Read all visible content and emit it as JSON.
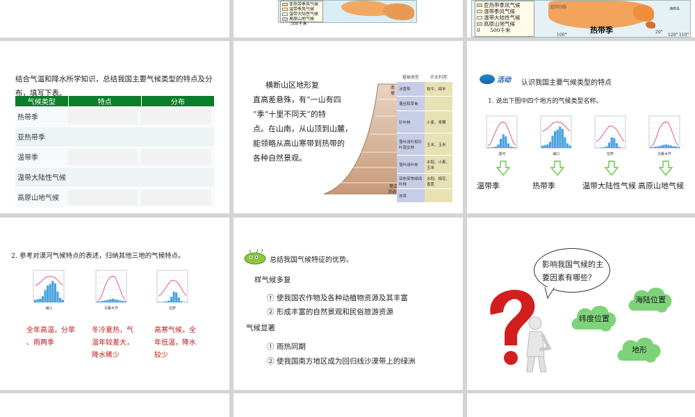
{
  "top_slides": {
    "mid_legend": [
      "亚热带季风气候",
      "温带季风气候",
      "温带大陆性气候",
      "高原山地气候"
    ],
    "mid_scale": "500千米",
    "right_legend": [
      "亚热带季风气候",
      "温带季风气候",
      "温带大陆性气候",
      "高原山地气候"
    ],
    "right_scale_0": "0",
    "right_scale": "500千米",
    "right_lat_label": "北回归线",
    "right_lon1": "100°",
    "right_lon2": "120°",
    "right_lon3": "110°",
    "right_lat2": "20°",
    "right_bottom_label": "热带季",
    "right_island": "海南岛"
  },
  "slide_table": {
    "intro": "结合气温和降水所学知识，总结我国主要气候类型的特点及分布，填写下表。",
    "headers": [
      "气候类型",
      "特点",
      "分布"
    ],
    "rows": [
      "热带季",
      "亚热带季",
      "温带季",
      "温带大陆性气候",
      "高原山地气候"
    ]
  },
  "slide_hengduan": {
    "line1": "横断山区地形复",
    "line2": "直高差悬殊，有“一山有四",
    "line3": "”季“十里不同天”的特",
    "line4": "点。在山南，从山顶到山麓，",
    "line5": "能领略从高山寒带到热带的",
    "line6": "各种自然景观。",
    "col_head_1": "植被类型",
    "col_head_2": "农业利用",
    "top_label": "南",
    "top_label_2": "坡",
    "bottom_label": "怒江",
    "bottom_label_2": "河谷",
    "veg_rows": [
      {
        "veg": "冰雪带",
        "agri": "牧牛、绵羊"
      },
      {
        "veg": "灌丛和草甸",
        "agri": ""
      },
      {
        "veg": "针叶林",
        "agri": "小麦、青稞"
      },
      {
        "veg": "落叶阔叶和针叶混交林",
        "agri": "玉米、玉米"
      },
      {
        "veg": "落叶阔叶林",
        "agri": "水稻、小麦、玉米"
      },
      {
        "veg": "亚热带常绿阔叶林",
        "agri": "水稻、棉花、香蕉"
      },
      {
        "veg": "热带",
        "agri": ""
      }
    ]
  },
  "slide_activity": {
    "logo": "活动",
    "title": "认识我国主要气候类型的特点",
    "question": "1. 说出下图中四个地方的气候类型名称。",
    "charts": [
      "漠河",
      "海口",
      "拉萨",
      "乌鲁木齐"
    ],
    "labels": [
      "温带季",
      "热带季",
      "温带大陆性气候",
      "高原山地气候"
    ]
  },
  "slide_features": {
    "title": "2. 参考对漠河气候特点的表述，归纳其他三地的气候特点。",
    "charts": [
      "海口",
      "乌鲁木齐",
      "拉萨"
    ],
    "desc1": [
      "全年高温，分旱",
      "、雨两季"
    ],
    "desc2": [
      "冬冷夏热，气",
      "温年较差大，",
      "降水稀少"
    ],
    "desc3": [
      "高寒气候，全",
      "年低温，降水",
      "较少"
    ]
  },
  "slide_advantages": {
    "title": "总结我国气候特征的优势。",
    "h1": "样气候多复",
    "item1": "① 使我国农作物及各种动植物资源及其丰富",
    "item2": "② 形成丰富的自然景观和民俗旅游资源",
    "h2": "气候显著",
    "item3": "① 雨热同期",
    "item4": "② 使我国南方地区成为回归线沙漠带上的绿洲"
  },
  "slide_factors": {
    "question": "影响我国气候的主要因素有哪些？",
    "cloud1": "海陆位置",
    "cloud2": "纬度位置",
    "cloud3": "地形"
  },
  "colors": {
    "table_header": "#0b7d2b",
    "red_text": "#c01818",
    "cloud_green": "#7ed37a",
    "question_mark": "#d21e1e"
  }
}
